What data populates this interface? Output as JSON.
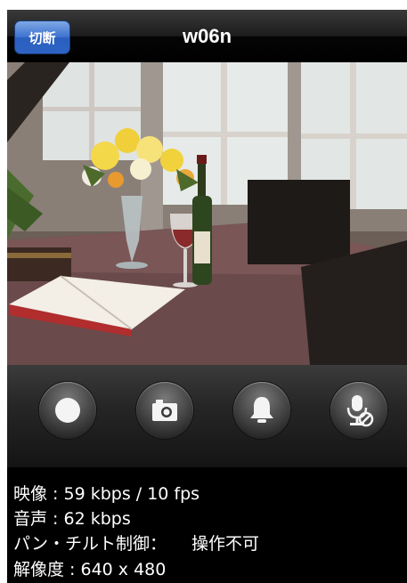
{
  "navbar": {
    "title": "w06n",
    "disconnect_label": "切断"
  },
  "controls": {
    "buttons": [
      {
        "icon": "record-icon"
      },
      {
        "icon": "camera-icon"
      },
      {
        "icon": "bell-icon"
      },
      {
        "icon": "microphone-off-icon"
      }
    ]
  },
  "info": {
    "video": "映像 : 59 kbps / 10 fps",
    "audio": "音声 : 62 kbps",
    "pantilt_label": "パン・チルト制御：",
    "pantilt_value": "操作不可",
    "resolution": "解像度 : 640 x 480"
  },
  "colors": {
    "button_blue": "#3f73cf",
    "background": "#000000",
    "text": "#ffffff"
  }
}
